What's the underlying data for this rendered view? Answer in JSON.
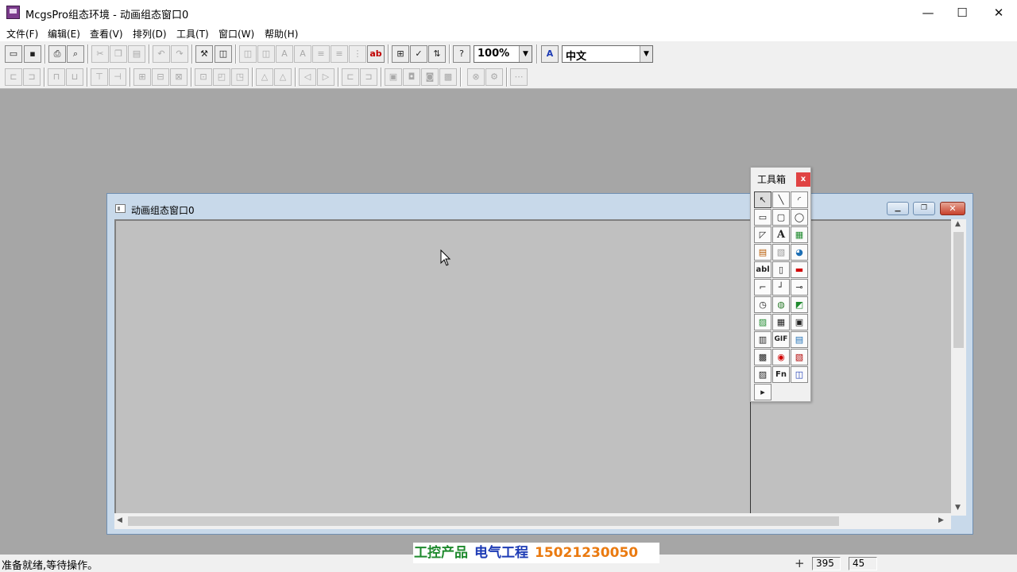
{
  "window": {
    "title": "McgsPro组态环境 - 动画组态窗口0",
    "controls": {
      "minimize": "—",
      "maximize": "☐",
      "close": "✕"
    }
  },
  "menu": [
    "文件(F)",
    "编辑(E)",
    "查看(V)",
    "排列(D)",
    "工具(T)",
    "窗口(W)",
    "帮助(H)"
  ],
  "toolbar": {
    "zoom": {
      "value": "100%",
      "arrow": "▼"
    },
    "language": {
      "value": "中文",
      "arrow": "▼"
    },
    "icons": {
      "new": "▭",
      "save": "▪",
      "print": "⎙",
      "preview": "⌕",
      "cut": "✂",
      "copy": "❐",
      "paste": "▤",
      "undo": "↶",
      "redo": "↷",
      "tools": "⚒",
      "properties": "◫",
      "text_a": "A",
      "align_lines": "≡",
      "grid": "⋮",
      "spell": "ab",
      "dlg1": "⊞",
      "check": "✓",
      "sort": "⇅",
      "help": "?",
      "ime": "A"
    },
    "align_icons": [
      "⊏",
      "⊐",
      "⊓",
      "⊔",
      "⊤",
      "⊣",
      "⊞",
      "⊟",
      "⊠",
      "⊡",
      "◰",
      "◳",
      "△",
      "◁",
      "▷",
      "⊏",
      "⊐",
      "▣",
      "◘",
      "◙",
      "▩",
      "⊗",
      "⚙",
      "⋯",
      "⋮"
    ]
  },
  "child_window": {
    "title": "动画组态窗口0",
    "controls": {
      "minimize": "▁",
      "restore": "❐",
      "close": "✕"
    },
    "scroll": {
      "up": "▲",
      "down": "▼",
      "left": "◀",
      "right": "▶"
    }
  },
  "toolbox": {
    "title": "工具箱",
    "close": "x",
    "tools": [
      "↖",
      "╲",
      "◜",
      "▭",
      "▢",
      "◯",
      "◸",
      "A",
      "▦",
      "▤",
      "▧",
      "◕",
      "abl",
      "▯",
      "▬",
      "⌐",
      "┘",
      "⊸",
      "◷",
      "◍",
      "◩",
      "▨",
      "▦",
      "▣",
      "▥",
      "GIF",
      "▤",
      "▩",
      "◉",
      "▧",
      "▨",
      "Fn",
      "◫",
      "▸"
    ]
  },
  "statusbar": {
    "text": "准备就绪,等待操作。",
    "coord_icon": "+",
    "x": "395",
    "y": "45"
  },
  "watermark": {
    "part1": "工控产品",
    "part2": "电气工程",
    "part3": "15021230050"
  }
}
